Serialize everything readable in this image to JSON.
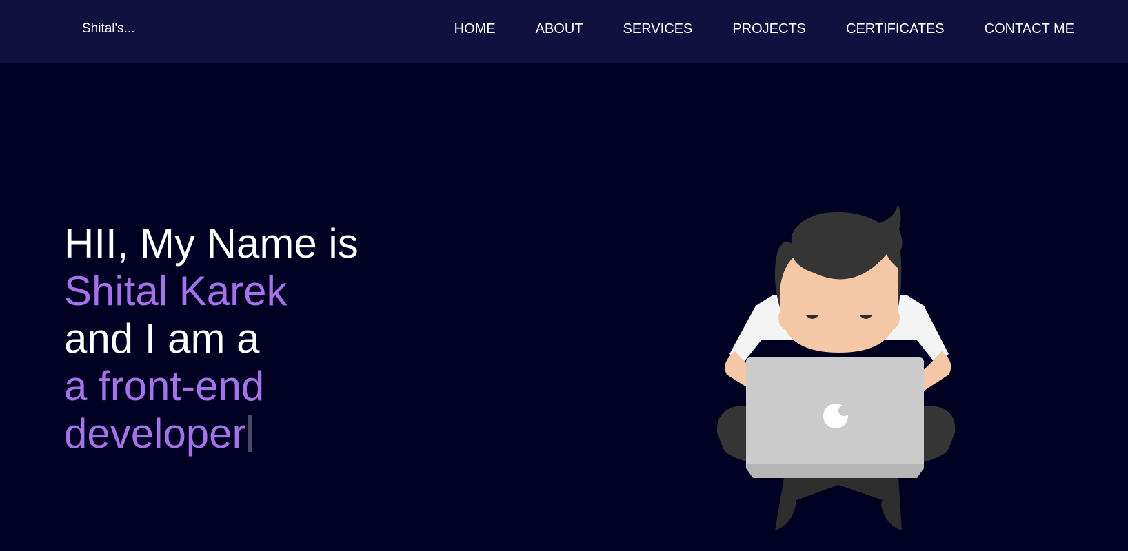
{
  "navbar": {
    "brand": "Shital's...",
    "links": [
      {
        "label": "HOME"
      },
      {
        "label": "ABOUT"
      },
      {
        "label": "SERVICES"
      },
      {
        "label": "PROJECTS"
      },
      {
        "label": "CERTIFICATES"
      },
      {
        "label": "CONTACT ME"
      }
    ]
  },
  "hero": {
    "line1": "HII, My Name is",
    "name": "Shital Karek",
    "line3": "and I am a",
    "role_line1": "a front-end",
    "role_line2": "developer"
  },
  "colors": {
    "background": "#000022",
    "navbar": "#11113f",
    "accent": "#a672ea",
    "text": "#ffffff"
  },
  "icons": {
    "illustration": "developer-with-laptop-illustration",
    "laptop_logo": "apple-logo-icon"
  }
}
